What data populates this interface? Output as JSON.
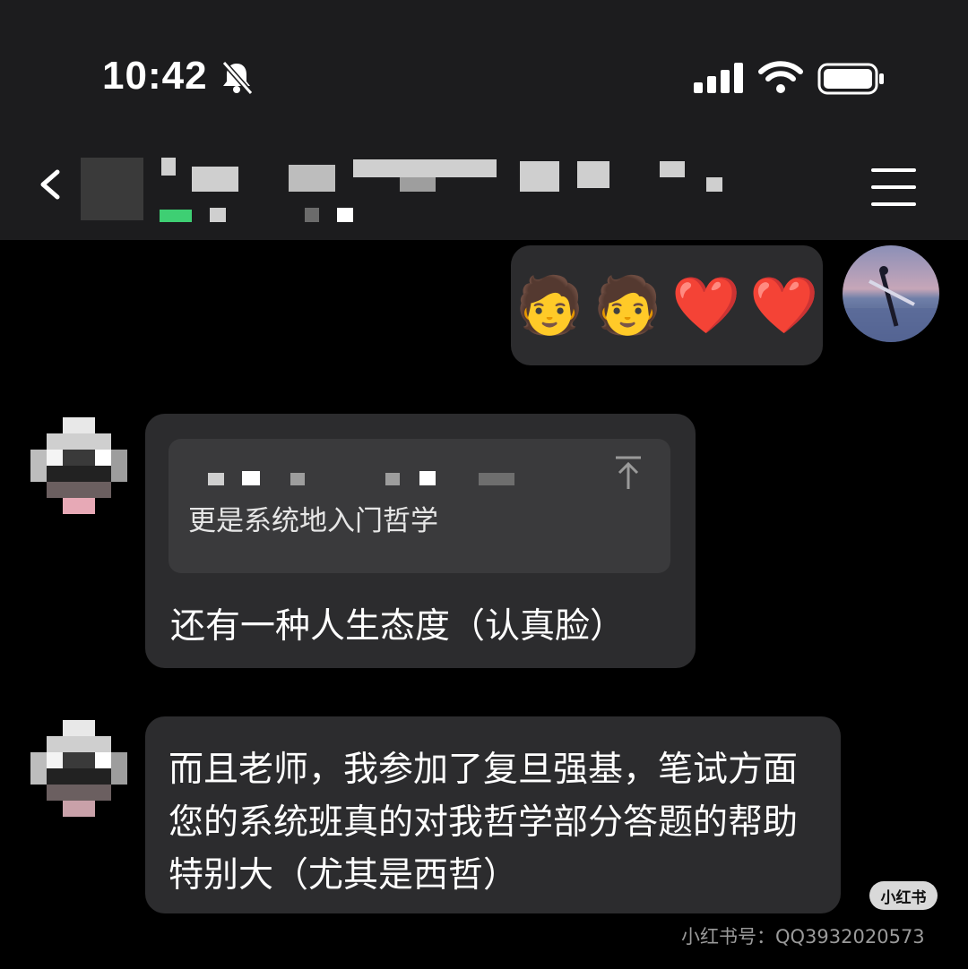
{
  "status_bar": {
    "time": "10:42"
  },
  "chat": {
    "sent_emoji": [
      "🧑",
      "🧑",
      "❤️",
      "❤️"
    ],
    "quote_text": "更是系统地入门哲学",
    "reply_text": "还有一种人生态度（认真脸）",
    "long_message": "而且老师，我参加了复旦强基，笔试方面您的系统班真的对我哲学部分答题的帮助特别大（尤其是西哲）"
  },
  "watermark": {
    "badge": "小红书",
    "id_text": "小红书号：QQ3932020573"
  },
  "icons": [
    "bell-slash-icon",
    "signal-icon",
    "wifi-icon",
    "battery-icon",
    "back-icon",
    "menu-icon",
    "quote-jump-icon"
  ],
  "colors": {
    "background": "#000000",
    "header": "#1c1c1e",
    "bubble": "#2c2c2e",
    "quote": "#3a3a3c"
  }
}
